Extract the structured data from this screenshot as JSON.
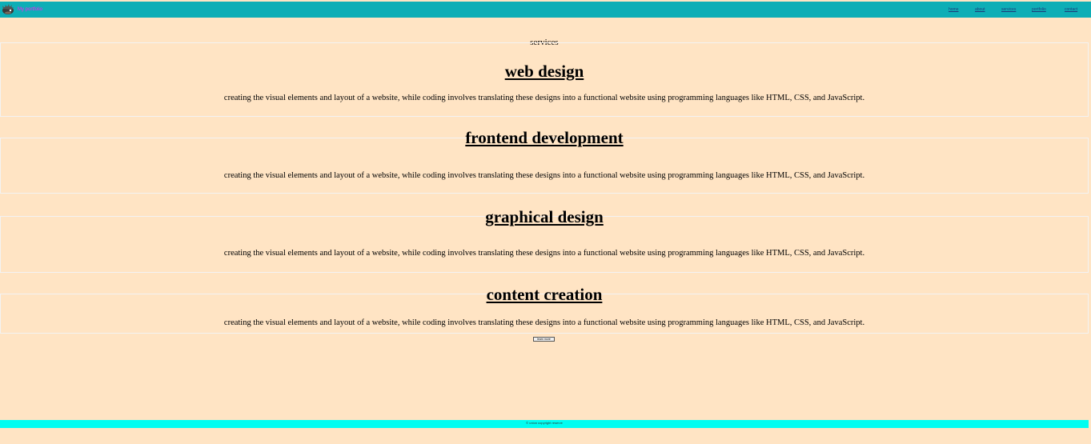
{
  "colors": {
    "page_background": "#ffe4c4",
    "header_background": "#0eaeb6",
    "brand_text": "#ff1cf0",
    "nav_link": "#1d3a7a",
    "footer_background": "#00fdf1",
    "box_border": "#f3f3f3"
  },
  "header": {
    "logo_icon": "hedgehog-logo-icon",
    "brand": "My portfolio",
    "nav": [
      "home",
      "about",
      "services",
      "portfolio",
      "contact"
    ]
  },
  "services": {
    "title": "services",
    "items": [
      {
        "heading": "web design",
        "description": "creating the visual elements and layout of a website, while coding involves translating these designs into a functional website using programming languages like HTML, CSS, and JavaScript."
      },
      {
        "heading": "frontend development",
        "description": "creating the visual elements and layout of a website, while coding involves translating these designs into a functional website using programming languages like HTML, CSS, and JavaScript."
      },
      {
        "heading": "graphical design",
        "description": "creating the visual elements and layout of a website, while coding involves translating these designs into a functional website using programming languages like HTML, CSS, and JavaScript."
      },
      {
        "heading": "content creation",
        "description": "creating the visual elements and layout of a website, while coding involves translating these designs into a functional website using programming languages like HTML, CSS, and JavaScript."
      }
    ],
    "button_label": "learn more"
  },
  "footer": {
    "text": "© union copyright reserve"
  }
}
